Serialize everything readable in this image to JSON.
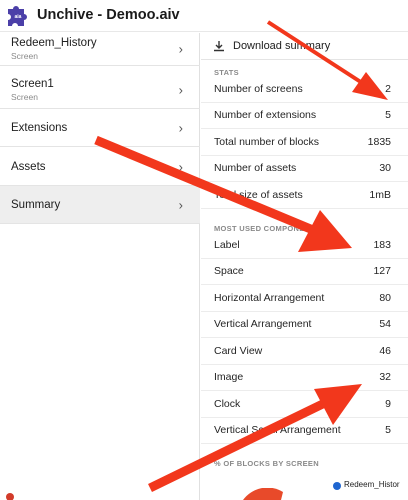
{
  "app": {
    "title": "Unchive - Demoo.aiv",
    "logo_color": "#4b3fa8"
  },
  "sidebar": {
    "items": [
      {
        "label": "Redeem_History",
        "sub": "Screen",
        "chevron": "›"
      },
      {
        "label": "Screen1",
        "sub": "Screen",
        "chevron": "›"
      },
      {
        "label": "Extensions",
        "chevron": "›"
      },
      {
        "label": "Assets",
        "chevron": "›"
      },
      {
        "label": "Summary",
        "chevron": "›",
        "selected": true
      }
    ]
  },
  "summary": {
    "download_label": "Download summary",
    "stats_heading": "STATS",
    "stats": [
      {
        "name": "Number of screens",
        "value": "2"
      },
      {
        "name": "Number of extensions",
        "value": "5"
      },
      {
        "name": "Total number of blocks",
        "value": "1835"
      },
      {
        "name": "Number of assets",
        "value": "30"
      },
      {
        "name": "Total size of assets",
        "value": "1mB"
      }
    ],
    "components_heading": "MOST USED COMPONENTS",
    "components": [
      {
        "name": "Label",
        "value": "183"
      },
      {
        "name": "Space",
        "value": "127"
      },
      {
        "name": "Horizontal Arrangement",
        "value": "80"
      },
      {
        "name": "Vertical Arrangement",
        "value": "54"
      },
      {
        "name": "Card View",
        "value": "46"
      },
      {
        "name": "Image",
        "value": "32"
      },
      {
        "name": "Clock",
        "value": "9"
      },
      {
        "name": "Vertical Scroll Arrangement",
        "value": "5"
      }
    ],
    "blocks_heading": "% OF BLOCKS BY SCREEN",
    "legend_label": "Redeem_Histor",
    "legend_color": "#1f66d0"
  },
  "annotation_color": "#f2371c"
}
